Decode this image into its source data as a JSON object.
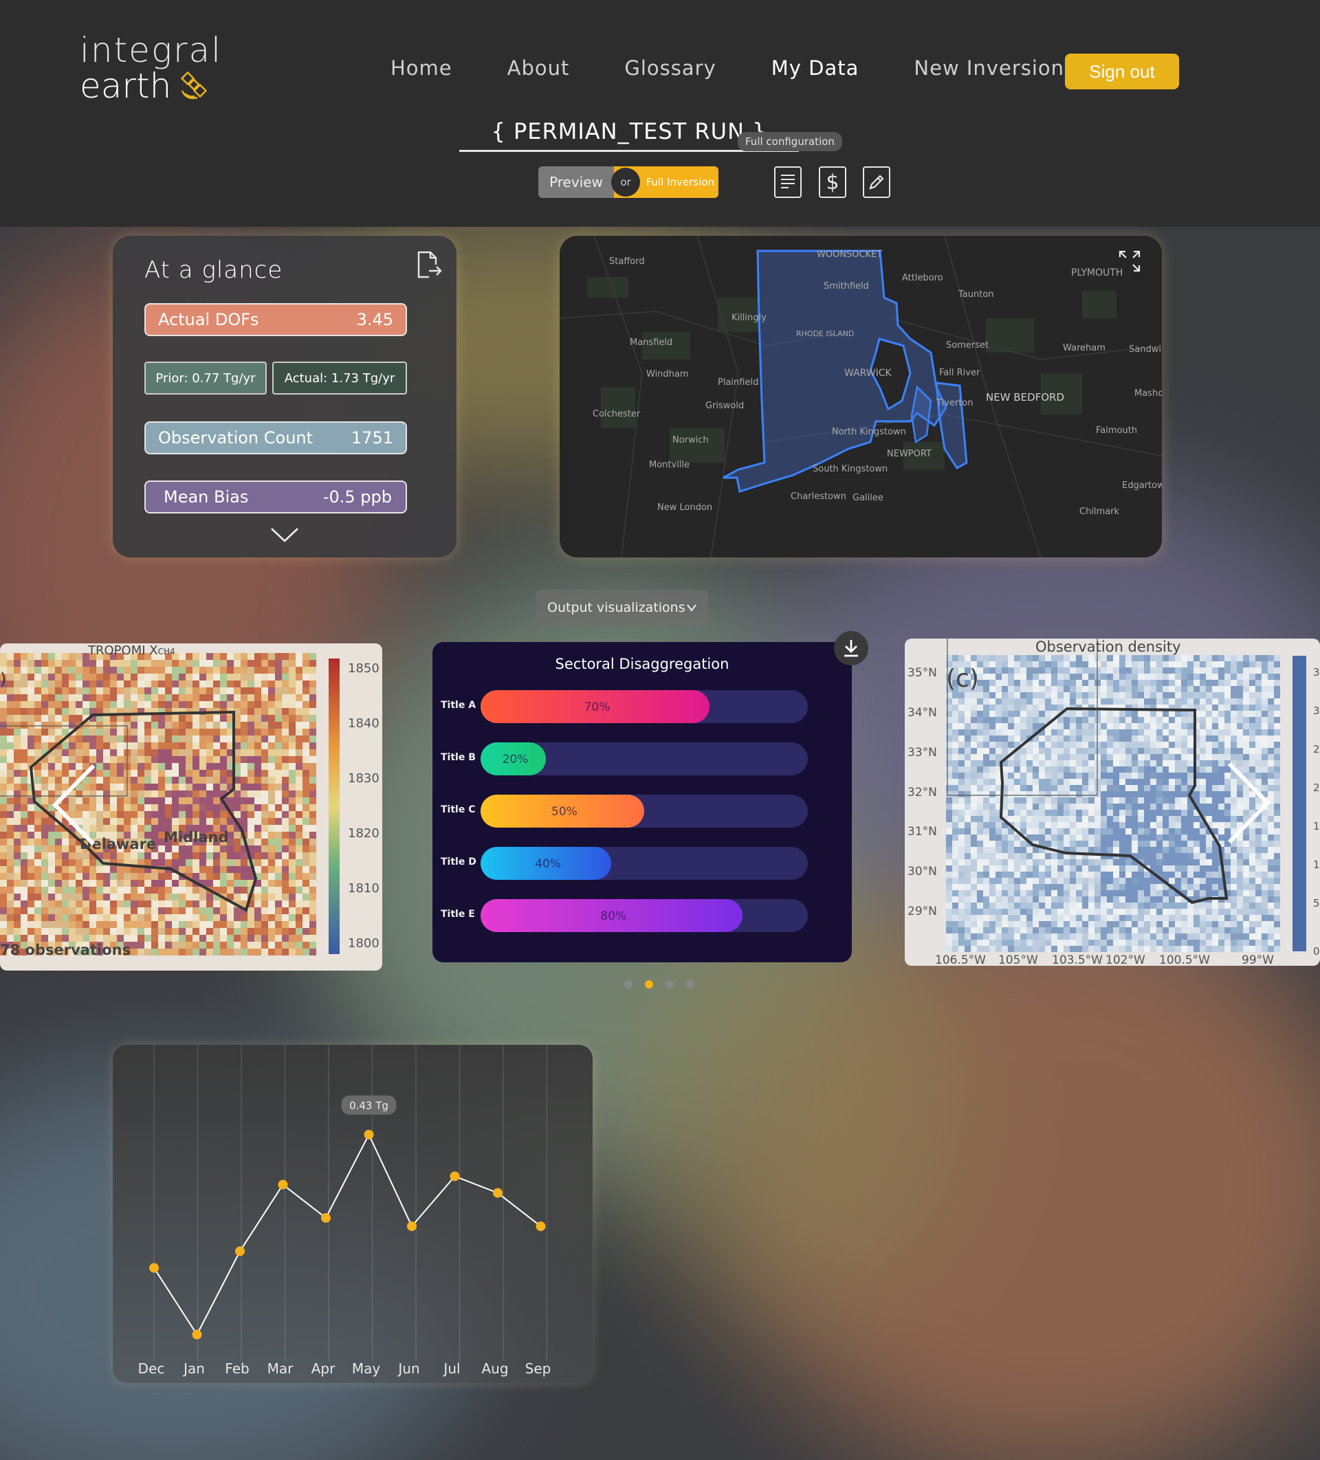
{
  "app": {
    "logo_line1": "integral",
    "logo_line2": "earth"
  },
  "nav": {
    "items": [
      "Home",
      "About",
      "Glossary",
      "My Data",
      "New Inversion"
    ],
    "active": "My Data",
    "signout": "Sign out"
  },
  "run": {
    "title": "{ PERMIAN_TEST RUN }",
    "tooltip": "Full configuration",
    "toggle_preview": "Preview",
    "toggle_or": "or",
    "toggle_full": "Full Inversion"
  },
  "glance": {
    "title": "At a glance",
    "actual_dofs_label": "Actual DOFs",
    "actual_dofs_value": "3.45",
    "prior": "Prior: 0.77 Tg/yr",
    "actual": "Actual: 1.73 Tg/yr",
    "obs_label": "Observation Count",
    "obs_value": "1751",
    "bias_label": "Mean Bias",
    "bias_value": "-0.5 ppb"
  },
  "map": {
    "labels": [
      "WOONSOCKET",
      "Stafford",
      "Smithfield",
      "Attleboro",
      "PLYMOUTH",
      "Taunton",
      "Killingly",
      "RHODE ISLAND",
      "Mansfield",
      "Somerset",
      "Wareham",
      "Sandwic",
      "Windham",
      "Plainfield",
      "WARWICK",
      "Fall River",
      "Masho",
      "Griswold",
      "Tiverton",
      "NEW BEDFORD",
      "Colchester",
      "North Kingstown",
      "Falmouth",
      "Norwich",
      "NEWPORT",
      "Montville",
      "South Kingstown",
      "Edgartown",
      "New London",
      "Charlestown",
      "Galilee",
      "Chilmark"
    ]
  },
  "viz_dropdown": "Output visualizations",
  "left_heat": {
    "title": "TROPOMI X",
    "title_sub": "CH4",
    "labels": [
      "Delaware",
      "Midland"
    ],
    "footer": "78 observations",
    "scale": [
      "1850",
      "1840",
      "1830",
      "1820",
      "1810",
      "1800"
    ],
    "panel_mark": ")"
  },
  "right_heat": {
    "title": "Observation density",
    "panel_mark": "(c)",
    "lat": [
      "35°N",
      "34°N",
      "33°N",
      "32°N",
      "31°N",
      "30°N",
      "29°N"
    ],
    "lon": [
      "106.5°W",
      "105°W",
      "103.5°W",
      "102°W",
      "100.5°W",
      "99°W"
    ],
    "scale": [
      "3",
      "3",
      "2",
      "2",
      "1",
      "1",
      "5",
      "0"
    ]
  },
  "sectoral": {
    "title": "Sectoral Disaggregation",
    "rows": [
      {
        "label": "Title A",
        "pct_text": "70%",
        "pct": 0.7,
        "from": "#ff5a36",
        "to": "#e0198f"
      },
      {
        "label": "Title B",
        "pct_text": "20%",
        "pct": 0.2,
        "from": "#17d39a",
        "to": "#1bc874"
      },
      {
        "label": "Title C",
        "pct_text": "50%",
        "pct": 0.5,
        "from": "#ffc21f",
        "to": "#ff6d42"
      },
      {
        "label": "Title D",
        "pct_text": "40%",
        "pct": 0.4,
        "from": "#1ac3f0",
        "to": "#2f55e2"
      },
      {
        "label": "Title E",
        "pct_text": "80%",
        "pct": 0.8,
        "from": "#e63bd0",
        "to": "#7a2ee6"
      }
    ]
  },
  "carousel": {
    "count": 4,
    "active": 1
  },
  "chart_data": {
    "type": "line",
    "categories": [
      "Dec",
      "Jan",
      "Feb",
      "Mar",
      "Apr",
      "May",
      "Jun",
      "Jul",
      "Aug",
      "Sep"
    ],
    "values": [
      0.27,
      0.19,
      0.29,
      0.37,
      0.33,
      0.43,
      0.32,
      0.38,
      0.36,
      0.32
    ],
    "tooltip": "0.43 Tg",
    "highlight_index": 5,
    "ylim": [
      0.15,
      0.48
    ],
    "color": "#f4b21a"
  }
}
